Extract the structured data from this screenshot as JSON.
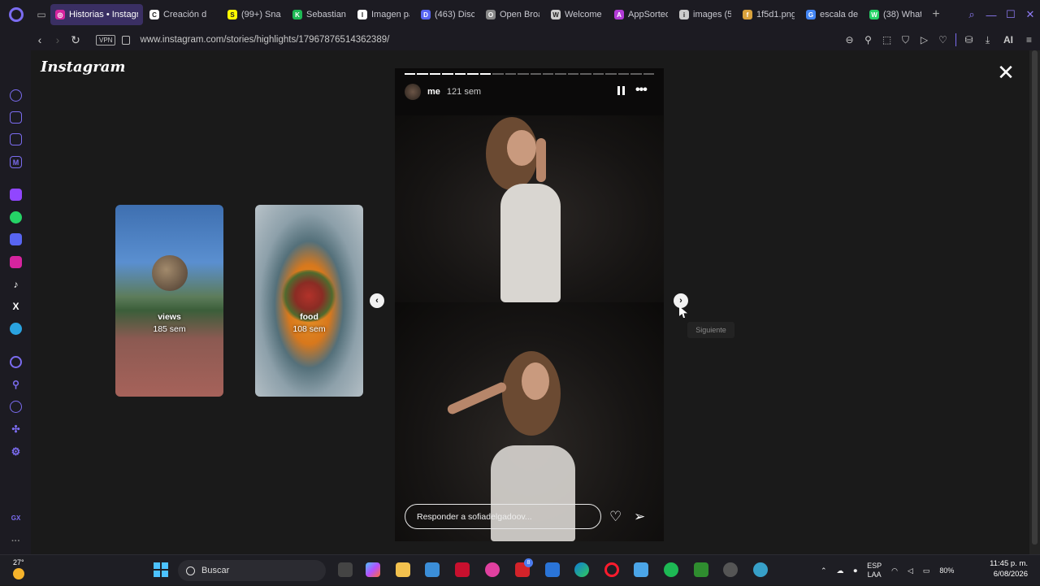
{
  "browser": {
    "tabs": [
      {
        "title": "Historias • Instagr",
        "active": true,
        "color": "#d6249f",
        "glyph": "◎"
      },
      {
        "title": "Creación d",
        "active": false,
        "color": "#ffffff",
        "glyph": "C"
      },
      {
        "title": "(99+) Sna",
        "active": false,
        "color": "#fffc00",
        "glyph": "S"
      },
      {
        "title": "Sebastian",
        "active": false,
        "color": "#1db954",
        "glyph": "K"
      },
      {
        "title": "Imagen pa",
        "active": false,
        "color": "#ffffff",
        "glyph": "I"
      },
      {
        "title": "(463) Disc",
        "active": false,
        "color": "#5865f2",
        "glyph": "D"
      },
      {
        "title": "Open Broa",
        "active": false,
        "color": "#888888",
        "glyph": "O"
      },
      {
        "title": "Welcome",
        "active": false,
        "color": "#cccccc",
        "glyph": "W"
      },
      {
        "title": "AppSorteo",
        "active": false,
        "color": "#b23bd6",
        "glyph": "A"
      },
      {
        "title": "images (5",
        "active": false,
        "color": "#cccccc",
        "glyph": "i"
      },
      {
        "title": "1f5d1.png",
        "active": false,
        "color": "#d9a23c",
        "glyph": "f"
      },
      {
        "title": "escala de",
        "active": false,
        "color": "#4285f4",
        "glyph": "G"
      },
      {
        "title": "(38) What",
        "active": false,
        "color": "#25d366",
        "glyph": "W"
      }
    ],
    "vpn_label": "VPN",
    "url": "www.instagram.com/stories/highlights/17967876514362389/",
    "ai_label": "AI"
  },
  "instagram": {
    "logo": "Instagram",
    "highlights": [
      {
        "title": "views",
        "age": "185 sem"
      },
      {
        "title": "food",
        "age": "108 sem"
      }
    ],
    "story": {
      "username": "me",
      "age": "121 sem",
      "segments_total": 20,
      "segments_done": 7,
      "reply_placeholder": "Responder a sofiadelgadoov..."
    },
    "next_tooltip": "Siguiente"
  },
  "taskbar": {
    "temperature": "27°",
    "search_label": "Buscar",
    "language": "ESP",
    "language_sub": "LAA",
    "battery": "80%",
    "time": "11:45 p. m.",
    "date": "6/08/2026",
    "notification_badge": "8"
  }
}
